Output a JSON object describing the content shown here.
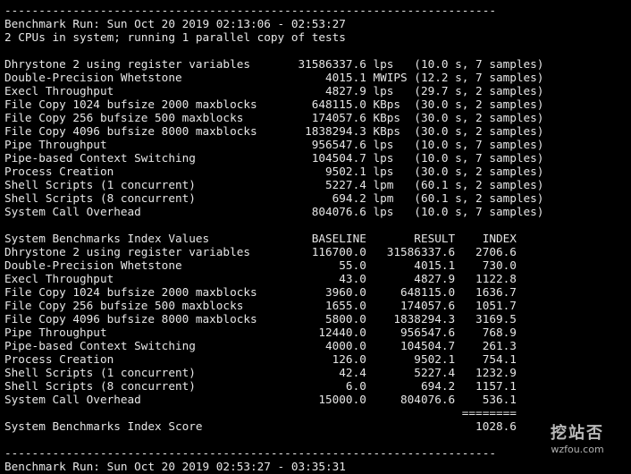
{
  "terminal": {
    "lines": [
      "------------------------------------------------------------------------",
      "Benchmark Run: Sun Oct 20 2019 02:13:06 - 02:53:27",
      "2 CPUs in system; running 1 parallel copy of tests",
      "",
      "Dhrystone 2 using register variables       31586337.6 lps   (10.0 s, 7 samples)",
      "Double-Precision Whetstone                     4015.1 MWIPS (12.2 s, 7 samples)",
      "Execl Throughput                               4827.9 lps   (29.7 s, 2 samples)",
      "File Copy 1024 bufsize 2000 maxblocks        648115.0 KBps  (30.0 s, 2 samples)",
      "File Copy 256 bufsize 500 maxblocks          174057.6 KBps  (30.0 s, 2 samples)",
      "File Copy 4096 bufsize 8000 maxblocks       1838294.3 KBps  (30.0 s, 2 samples)",
      "Pipe Throughput                              956547.6 lps   (10.0 s, 7 samples)",
      "Pipe-based Context Switching                 104504.7 lps   (10.0 s, 7 samples)",
      "Process Creation                               9502.1 lps   (30.0 s, 2 samples)",
      "Shell Scripts (1 concurrent)                   5227.4 lpm   (60.1 s, 2 samples)",
      "Shell Scripts (8 concurrent)                    694.2 lpm   (60.1 s, 2 samples)",
      "System Call Overhead                         804076.6 lps   (10.0 s, 7 samples)",
      "",
      "System Benchmarks Index Values               BASELINE       RESULT    INDEX",
      "Dhrystone 2 using register variables         116700.0   31586337.6   2706.6",
      "Double-Precision Whetstone                       55.0       4015.1    730.0",
      "Execl Throughput                                 43.0       4827.9   1122.8",
      "File Copy 1024 bufsize 2000 maxblocks          3960.0     648115.0   1636.7",
      "File Copy 256 bufsize 500 maxblocks            1655.0     174057.6   1051.7",
      "File Copy 4096 bufsize 8000 maxblocks          5800.0    1838294.3   3169.5",
      "Pipe Throughput                               12440.0     956547.6    768.9",
      "Pipe-based Context Switching                   4000.0     104504.7    261.3",
      "Process Creation                                126.0       9502.1    754.1",
      "Shell Scripts (1 concurrent)                     42.4       5227.4   1232.9",
      "Shell Scripts (8 concurrent)                      6.0        694.2   1157.1",
      "System Call Overhead                          15000.0     804076.6    536.1",
      "                                                                   ========",
      "System Benchmarks Index Score                                        1028.6",
      "",
      "------------------------------------------------------------------------",
      "Benchmark Run: Sun Oct 20 2019 02:53:27 - 03:35:31"
    ]
  },
  "watermark": {
    "logo": "挖站否",
    "url": "wzfou.com"
  }
}
